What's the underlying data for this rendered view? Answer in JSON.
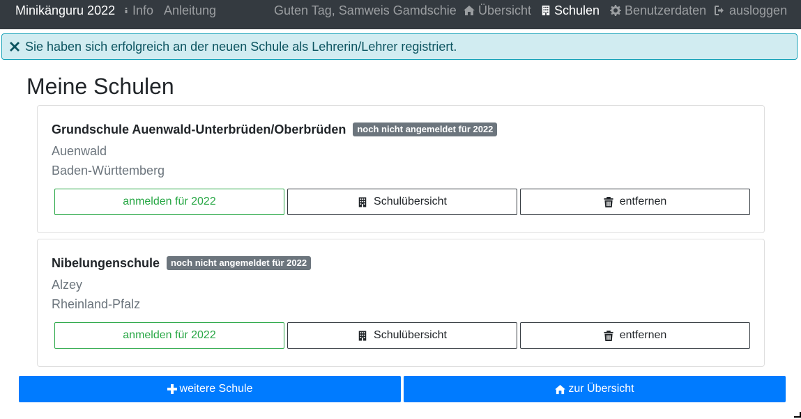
{
  "navbar": {
    "brand": "Minikänguru 2022",
    "info_label": "Info",
    "anleitung_label": "Anleitung",
    "greeting": "Guten Tag, Samweis Gamdschie",
    "uebersicht_label": "Übersicht",
    "schulen_label": "Schulen",
    "benutzerdaten_label": "Benutzerdaten",
    "ausloggen_label": "ausloggen"
  },
  "alert": {
    "message": "Sie haben sich erfolgreich an der neuen Schule als Lehrerin/Lehrer registriert."
  },
  "page": {
    "title": "Meine Schulen"
  },
  "schools": [
    {
      "name": "Grundschule Auenwald-Unterbrüden/Oberbrüden",
      "badge": "noch nicht angemeldet für 2022",
      "city": "Auenwald",
      "state": "Baden-Württemberg",
      "register_label": "anmelden für 2022",
      "overview_label": "Schulübersicht",
      "remove_label": "entfernen"
    },
    {
      "name": "Nibelungenschule",
      "badge": "noch nicht angemeldet für 2022",
      "city": "Alzey",
      "state": "Rheinland-Pfalz",
      "register_label": "anmelden für 2022",
      "overview_label": "Schulübersicht",
      "remove_label": "entfernen"
    }
  ],
  "footer_buttons": {
    "add_school_label": "weitere Schule",
    "to_overview_label": "zur Übersicht"
  },
  "colors": {
    "navbar_bg": "#343a40",
    "alert_bg": "#d1ecf1",
    "success": "#28a745",
    "primary": "#007bff",
    "badge_bg": "#6c757d"
  },
  "icons": {
    "info": "info-icon",
    "home": "home-icon",
    "building": "building-icon",
    "gear": "gear-icon",
    "logout": "logout-icon",
    "close": "close-icon",
    "trash": "trash-icon",
    "plus": "plus-icon"
  }
}
